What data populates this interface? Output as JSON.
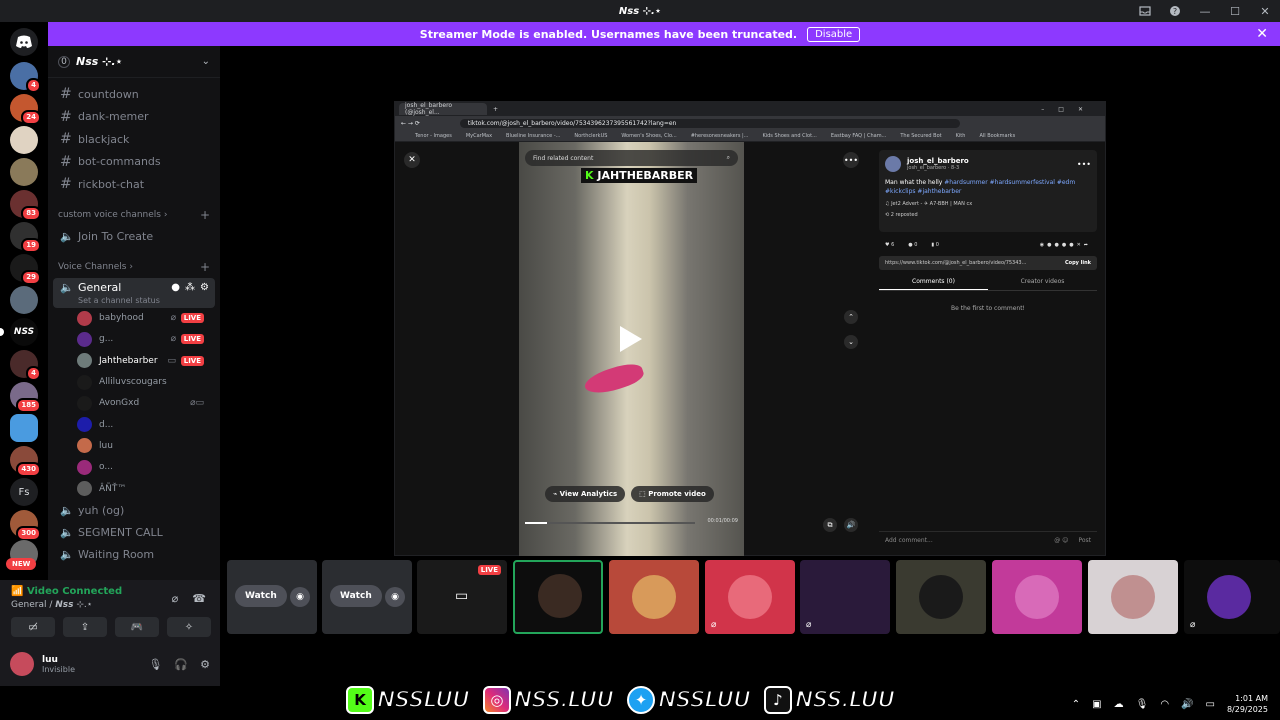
{
  "window": {
    "title": "𝙉𝙨𝙨 ⊹.⋆"
  },
  "banner": {
    "text": "Streamer Mode is enabled. Usernames have been truncated.",
    "disable_label": "Disable"
  },
  "rail": {
    "badges": [
      "4",
      "24",
      "83",
      "19",
      "29",
      "4",
      "185",
      "430",
      "300"
    ],
    "fs_label": "Fs",
    "new_label": "NEW"
  },
  "server": {
    "boost": "0",
    "name": "𝙉𝙨𝙨 ⊹.⋆",
    "text_channels": [
      "countdown",
      "dank-memer",
      "blackjack",
      "bot-commands",
      "rickbot-chat"
    ],
    "category_custom": "custom voice channels",
    "join_to_create": "Join To Create",
    "category_voice": "Voice Channels",
    "active_voice": {
      "name": "General",
      "status": "Set a channel status"
    },
    "members": [
      {
        "name": "babyhood",
        "live": "LIVE",
        "color": "#b13b4a"
      },
      {
        "name": "g...",
        "live": "LIVE",
        "color": "#5b2b8c"
      },
      {
        "name": "Jahthebarber",
        "live": "LIVE",
        "color": "#6e7b7a"
      },
      {
        "name": "Alliluvscougars",
        "live": "",
        "color": "#1a1a1a"
      },
      {
        "name": "AvonGxd",
        "live": "",
        "color": "#1a1a1a"
      },
      {
        "name": "d...",
        "live": "",
        "color": "#1d1daa"
      },
      {
        "name": "luu",
        "live": "",
        "color": "#c46a4a"
      },
      {
        "name": "o...",
        "live": "",
        "color": "#9a2a7a"
      },
      {
        "name": "ÂÑŤ™",
        "live": "",
        "color": "#5d5d5d"
      }
    ],
    "more_voice": [
      "yuh (og)",
      "SEGMENT CALL",
      "Waiting Room"
    ]
  },
  "voice_panel": {
    "connected": "Video Connected",
    "location": "General / 𝙉𝙨𝙨 ⊹.⋆"
  },
  "user": {
    "name": "luu",
    "status": "Invisible"
  },
  "browser": {
    "tab_title": "josh_el_barbero (@josh_el...",
    "url": "tiktok.com/@josh_el_barbero/video/7534396237395561742?lang=en",
    "bookmarks": [
      "Tenor - Images",
      "MyCarMax",
      "Blueline Insurance -...",
      "NorthclerkUS",
      "Women's Shoes, Clo...",
      "#heresonesneakers |...",
      "Kids Shoes and Clot...",
      "Eastbay FAQ | Cham...",
      "The Secured Bot",
      "Kith",
      "All Bookmarks"
    ]
  },
  "tiktok": {
    "search_placeholder": "Find related content",
    "brand": "JAHTHEBARBER",
    "view_analytics": "View Analytics",
    "promote": "Promote video",
    "time": "00:01/00:09",
    "author": "josh_el_barbero",
    "author_handle": "josh_el_barbero · 8-3",
    "caption": "Man what the helly",
    "tags": "#hardsummer #hardsummerfestival #edm #kickclips #jahthebarber",
    "music": "♫ Jet2 Advert - ✈ A7-BBH | MAN cx",
    "reposted": "2 reposted",
    "likes": "6",
    "comments": "0",
    "saves": "0",
    "link": "https://www.tiktok.com/@josh_el_barbero/video/75343...",
    "copy_link": "Copy link",
    "tab_comments": "Comments (0)",
    "tab_creator": "Creator videos",
    "first": "Be the first to comment!",
    "add_comment": "Add comment...",
    "post": "Post"
  },
  "tiles": {
    "watch_label": "Watch",
    "live_label": "LIVE"
  },
  "socials": [
    {
      "icon": "K",
      "label": "NSSLUU"
    },
    {
      "icon": "◎",
      "label": "NSS.LUU"
    },
    {
      "icon": "✦",
      "label": "NSSLUU"
    },
    {
      "icon": "♪",
      "label": "NSS.LUU"
    }
  ],
  "clock": {
    "time": "1:01 AM",
    "date": "8/29/2025"
  }
}
